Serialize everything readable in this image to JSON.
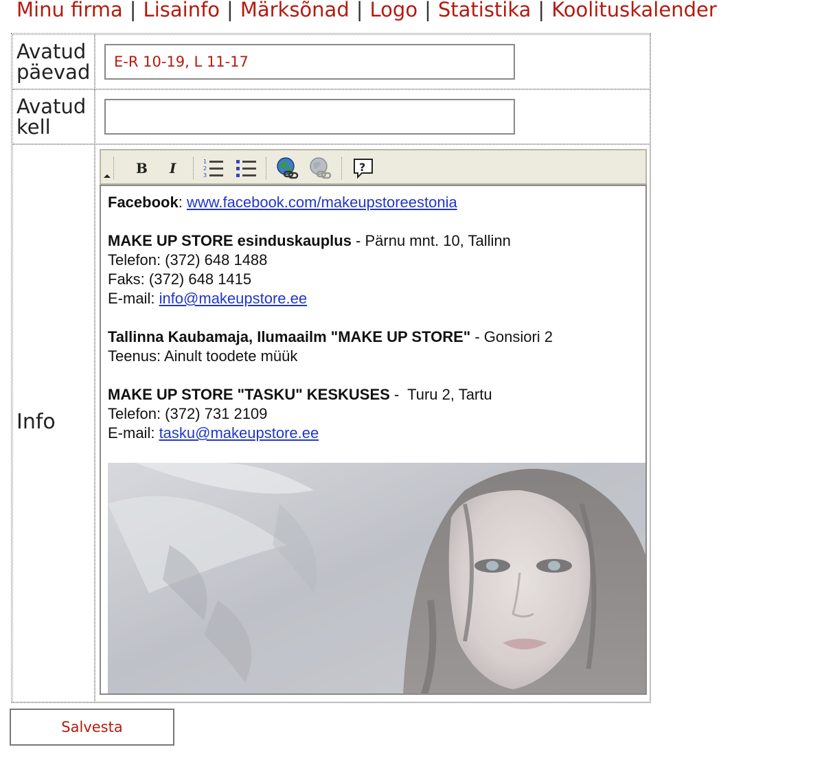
{
  "nav": {
    "items": [
      "Minu firma",
      "Lisainfo",
      "Märksõnad",
      "Logo",
      "Statistika",
      "Koolituskalender"
    ],
    "separator": "|"
  },
  "form": {
    "open_days": {
      "label_line1": "Avatud",
      "label_line2": "päevad",
      "value": "E-R 10-19, L 11-17"
    },
    "open_hours": {
      "label_line1": "Avatud",
      "label_line2": "kell",
      "value": ""
    },
    "info": {
      "label": "Info",
      "toolbar": {
        "buttons": [
          "bold-icon",
          "italic-icon",
          "ordered-list-icon",
          "unordered-list-icon",
          "insert-link-icon",
          "remove-link-icon",
          "help-icon"
        ]
      },
      "editor": {
        "facebook_label": "Facebook",
        "facebook_colon": ":",
        "facebook_link": "www.facebook.com/makeupstoreestonia",
        "store1_name": "MAKE UP STORE esinduskauplus",
        "store1_address": " - Pärnu mnt. 10, Tallinn",
        "store1_phone": "Telefon: (372) 648 1488",
        "store1_fax": "Faks: (372) 648 1415",
        "store1_email_label": "E-mail: ",
        "store1_email": "info@makeupstore.ee",
        "store2_name": "Tallinna Kaubamaja, Ilumaailm \"MAKE UP STORE\"",
        "store2_address": " - Gonsiori 2",
        "store2_service": "Teenus: Ainult toodete müük",
        "store3_name": "MAKE UP STORE \"TASKU\" KESKUSES",
        "store3_address": " -  Turu 2, Tartu",
        "store3_phone": "Telefon: (372) 731 2109",
        "store3_email_label": "E-mail: ",
        "store3_email": "tasku@makeupstore.ee"
      }
    }
  },
  "save_button": {
    "label": "Salvesta"
  },
  "colors": {
    "accent": "#b51a0e",
    "link": "#1f35cc",
    "toolbar_bg": "#ecebdd"
  }
}
